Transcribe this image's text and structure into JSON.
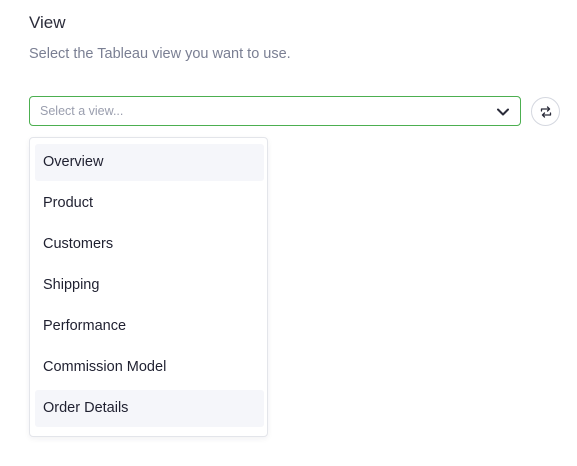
{
  "section": {
    "title": "View",
    "description": "Select the Tableau view you want to use."
  },
  "select": {
    "placeholder": "Select a view...",
    "icon": "chevron-down-icon",
    "border_color": "#4caf50"
  },
  "refresh_button": {
    "icon": "refresh-icon"
  },
  "dropdown": {
    "options": [
      {
        "label": "Overview",
        "highlighted": true
      },
      {
        "label": "Product",
        "highlighted": false
      },
      {
        "label": "Customers",
        "highlighted": false
      },
      {
        "label": "Shipping",
        "highlighted": false
      },
      {
        "label": "Performance",
        "highlighted": false
      },
      {
        "label": "Commission Model",
        "highlighted": false
      },
      {
        "label": "Order Details",
        "highlighted": true
      }
    ],
    "highlight_color": "#f5f6fa"
  }
}
